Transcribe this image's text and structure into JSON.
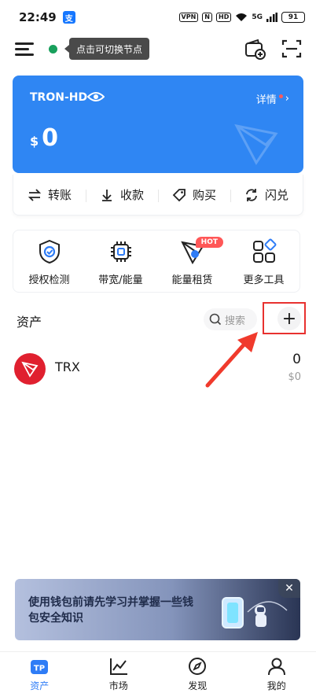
{
  "status_bar": {
    "time": "22:49",
    "app_icon": "支",
    "vpn": "VPN",
    "nfc": "N",
    "hd": "HD",
    "signal": "5G",
    "battery": "91"
  },
  "header": {
    "node_tooltip": "点击可切换节点"
  },
  "wallet": {
    "name": "TRON-HD",
    "details_label": "详情",
    "currency_symbol": "$",
    "balance": "0"
  },
  "actions": [
    {
      "label": "转账",
      "icon": "transfer-icon"
    },
    {
      "label": "收款",
      "icon": "receive-icon"
    },
    {
      "label": "购买",
      "icon": "buy-icon"
    },
    {
      "label": "闪兑",
      "icon": "swap-icon"
    }
  ],
  "tools": [
    {
      "label": "授权检测",
      "icon": "shield-icon"
    },
    {
      "label": "带宽/能量",
      "icon": "chip-icon"
    },
    {
      "label": "能量租赁",
      "icon": "energy-icon",
      "badge": "HOT"
    },
    {
      "label": "更多工具",
      "icon": "grid-icon"
    }
  ],
  "assets": {
    "title": "资产",
    "search_placeholder": "搜索",
    "add_label": "+",
    "tokens": [
      {
        "symbol": "TRX",
        "amount": "0",
        "value": "$0"
      }
    ]
  },
  "banner": {
    "text": "使用钱包前请先学习并掌握一些钱包安全知识",
    "close_label": "✕"
  },
  "tabs": [
    {
      "label": "资产",
      "active": true
    },
    {
      "label": "市场",
      "active": false
    },
    {
      "label": "发现",
      "active": false
    },
    {
      "label": "我的",
      "active": false
    }
  ],
  "colors": {
    "accent": "#2f86f3",
    "trx_red": "#e0202f",
    "highlight_red": "#e8312f",
    "node_green": "#18a05c"
  }
}
